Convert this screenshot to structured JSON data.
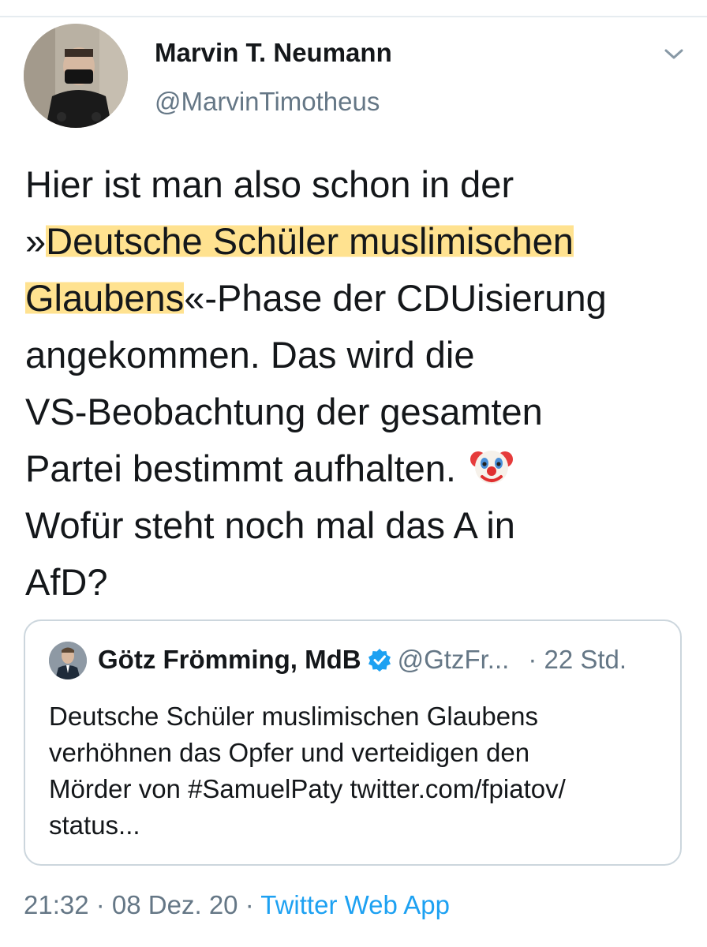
{
  "author": {
    "name": "Marvin T. Neumann",
    "handle": "@MarvinTimotheus",
    "avatar_icon": "user-avatar-photo"
  },
  "tweet": {
    "lines": [
      {
        "pre": "Hier ist man also schon in der",
        "hl": "",
        "post": ""
      },
      {
        "pre": "»",
        "hl": "Deutsche Schüler muslimischen",
        "post": ""
      },
      {
        "pre": "",
        "hl": "Glaubens",
        "post": "«-Phase der CDUisierung"
      },
      {
        "pre": "angekommen. Das wird die",
        "hl": "",
        "post": ""
      },
      {
        "pre": "VS-Beobachtung der gesamten",
        "hl": "",
        "post": ""
      },
      {
        "pre": "Partei bestimmt aufhalten.",
        "hl": "",
        "post": ""
      },
      {
        "pre": "Wofür steht noch mal das A in",
        "hl": "",
        "post": ""
      },
      {
        "pre": "AfD?",
        "hl": "",
        "post": ""
      }
    ],
    "emoji": "clown-face-emoji",
    "highlight_color": "#ffdd7d"
  },
  "quoted": {
    "name": "Götz Frömming, MdB",
    "handle": "@GtzFr...",
    "time": "· 22 Std.",
    "verified_color": "#1da1f2",
    "lines": [
      "Deutsche Schüler muslimischen Glaubens",
      "verhöhnen das Opfer und verteidigen den",
      "Mörder von #SamuelPaty twitter.com/fpiatov/",
      "status..."
    ]
  },
  "meta": {
    "time": "21:32",
    "sep1": " · ",
    "date": "08 Dez. 20",
    "sep2": " · ",
    "app": "Twitter Web App"
  },
  "colors": {
    "text": "#14171a",
    "secondary": "#657786",
    "accent": "#1da1f2",
    "border": "#ccd6dd"
  }
}
